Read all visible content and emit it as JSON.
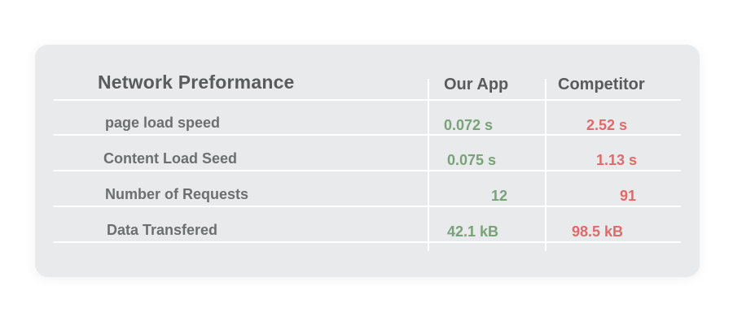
{
  "table": {
    "title": "Network Preformance",
    "columns": [
      "Our App",
      "Competitor"
    ],
    "rows": [
      {
        "label": "page load speed",
        "our_app": "0.072 s",
        "competitor": "2.52 s"
      },
      {
        "label": "Content Load Seed",
        "our_app": "0.075 s",
        "competitor": "1.13 s"
      },
      {
        "label": "Number of Requests",
        "our_app": "12",
        "competitor": "91"
      },
      {
        "label": "Data Transfered",
        "our_app": "42.1 kB",
        "competitor": "98.5 kB"
      }
    ]
  },
  "colors": {
    "card_background": "#e8eaeb",
    "heading_text": "#585c5c",
    "label_text": "#6b706f",
    "our_app_value": "#7aa27a",
    "competitor_value": "#e06a6a",
    "grid_lines": "#ffffff"
  }
}
